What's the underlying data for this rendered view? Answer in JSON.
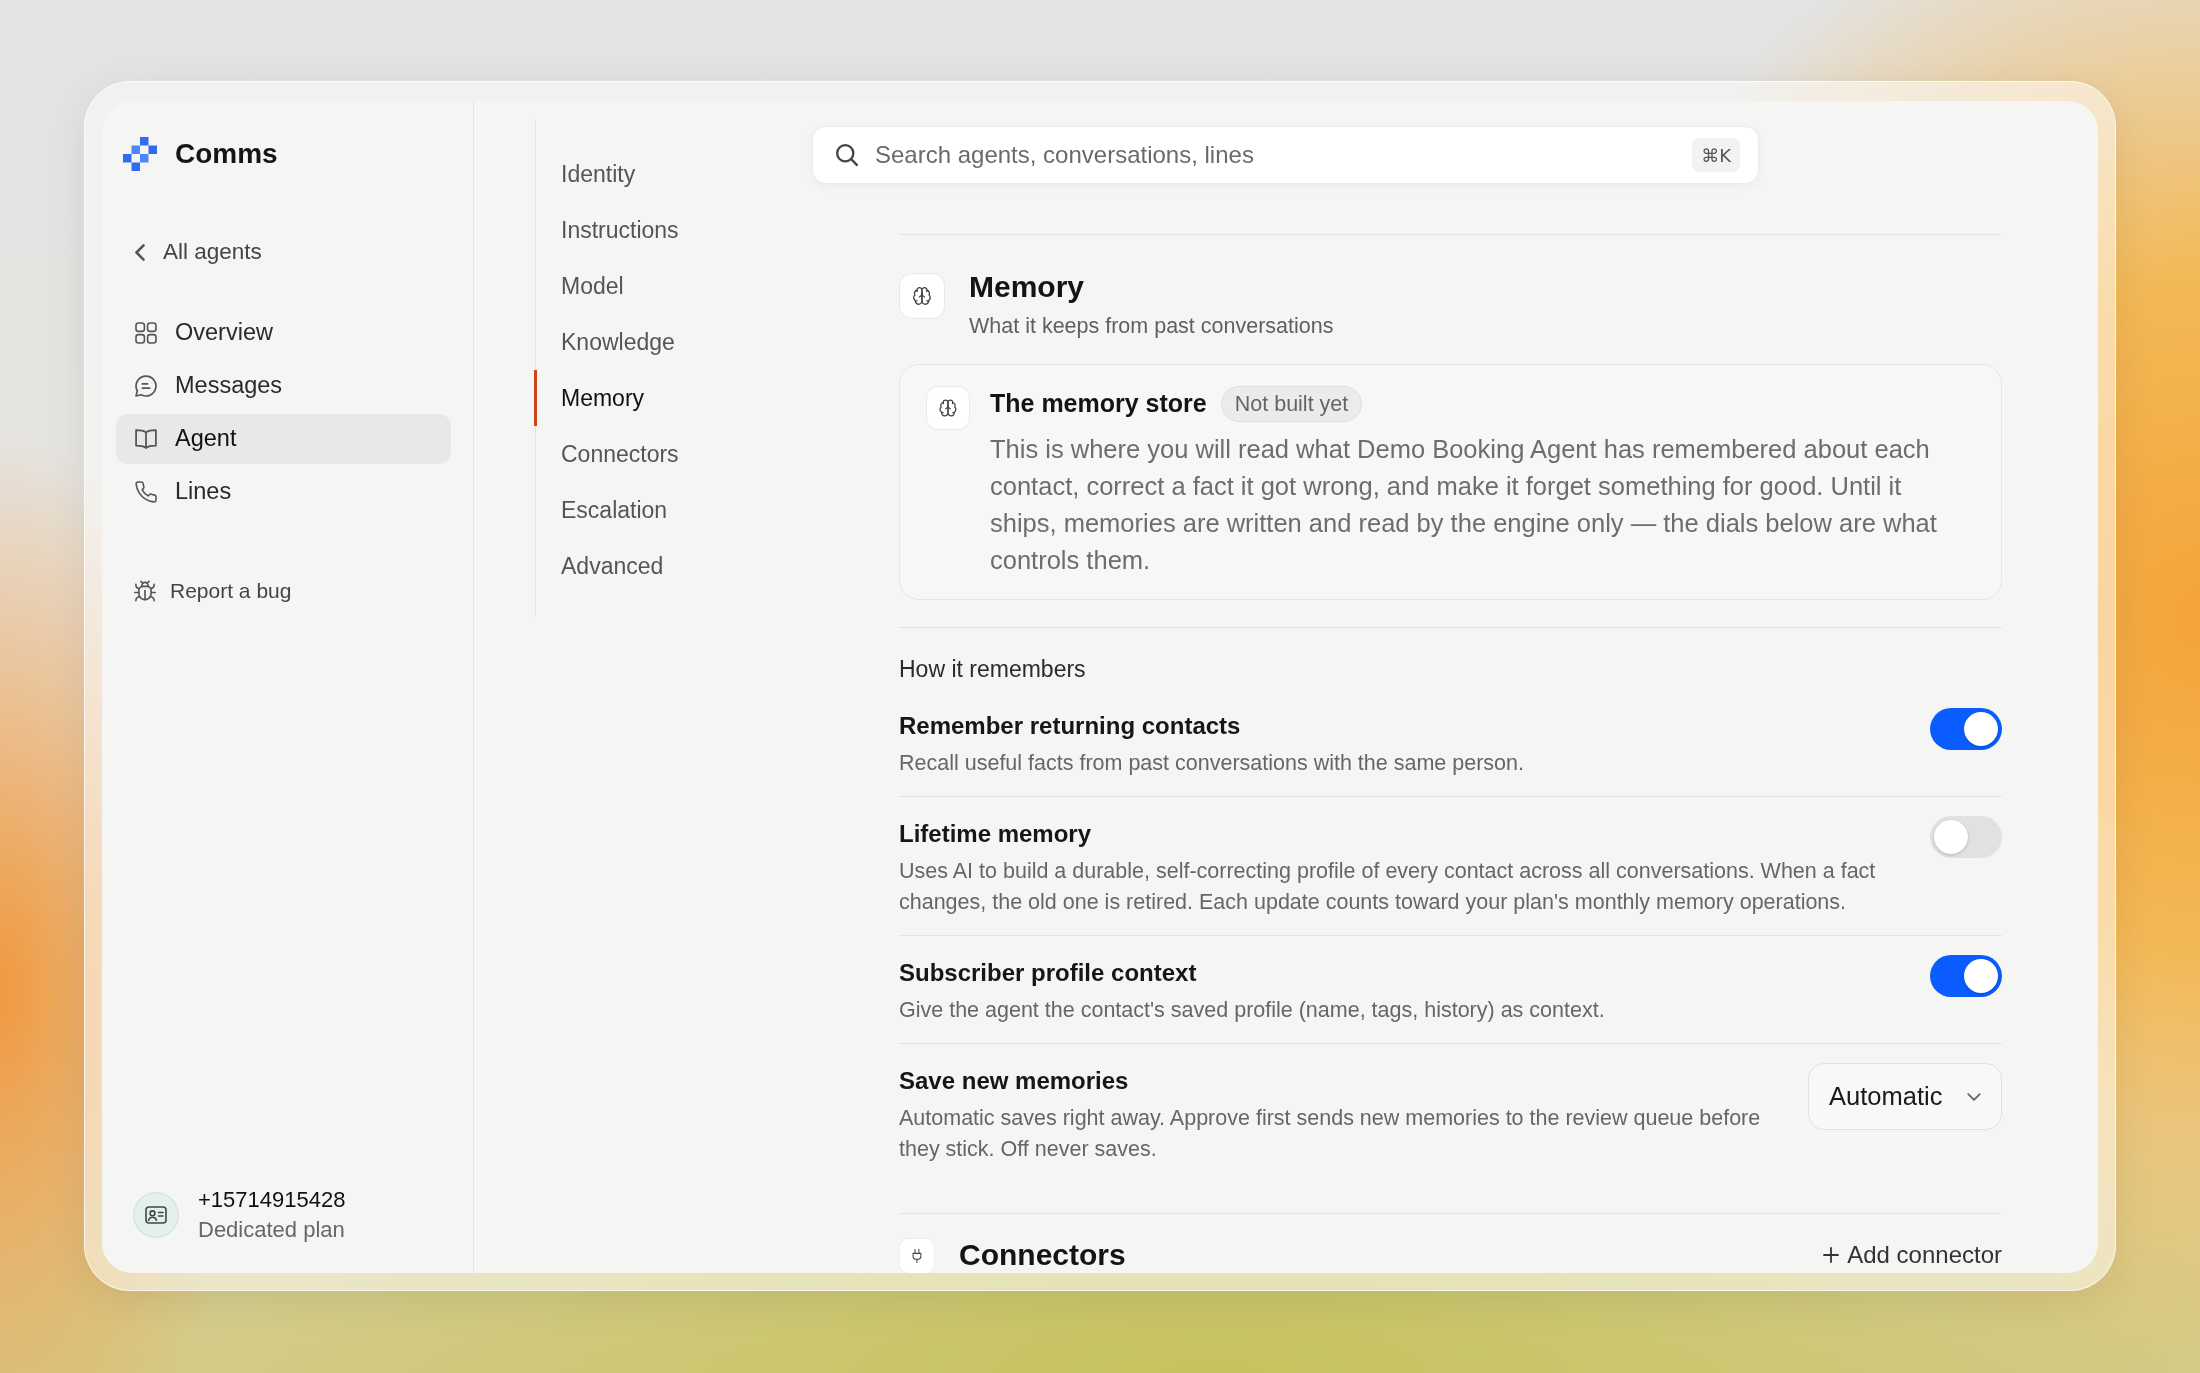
{
  "app": {
    "name": "Comms"
  },
  "sidebar": {
    "back_link": "All agents",
    "items": [
      {
        "label": "Overview",
        "selected": false
      },
      {
        "label": "Messages",
        "selected": false
      },
      {
        "label": "Agent",
        "selected": true
      },
      {
        "label": "Lines",
        "selected": false
      }
    ],
    "report_bug": "Report a bug",
    "account": {
      "phone": "+15714915428",
      "plan": "Dedicated plan"
    }
  },
  "section_nav": {
    "items": [
      {
        "label": "Identity",
        "selected": false
      },
      {
        "label": "Instructions",
        "selected": false
      },
      {
        "label": "Model",
        "selected": false
      },
      {
        "label": "Knowledge",
        "selected": false
      },
      {
        "label": "Memory",
        "selected": true
      },
      {
        "label": "Connectors",
        "selected": false
      },
      {
        "label": "Escalation",
        "selected": false
      },
      {
        "label": "Advanced",
        "selected": false
      }
    ]
  },
  "search": {
    "placeholder": "Search agents, conversations, lines",
    "shortcut": "⌘K"
  },
  "memory": {
    "title": "Memory",
    "subtitle": "What it keeps from past conversations",
    "store_card": {
      "title": "The memory store",
      "badge": "Not built yet",
      "body": "This is where you will read what Demo Booking Agent has remembered about each contact, correct a fact it got wrong, and make it forget something for good. Until it ships, memories are written and read by the engine only — the dials below are what controls them."
    },
    "group_label": "How it remembers",
    "settings": [
      {
        "kind": "toggle",
        "title": "Remember returning contacts",
        "description": "Recall useful facts from past conversations with the same person.",
        "on": true
      },
      {
        "kind": "toggle",
        "title": "Lifetime memory",
        "description": "Uses AI to build a durable, self-correcting profile of every contact across all conversations. When a fact changes, the old one is retired. Each update counts toward your plan's monthly memory operations.",
        "on": false
      },
      {
        "kind": "toggle",
        "title": "Subscriber profile context",
        "description": "Give the agent the contact's saved profile (name, tags, history) as context.",
        "on": true
      },
      {
        "kind": "select",
        "title": "Save new memories",
        "description": "Automatic saves right away. Approve first sends new memories to the review queue before they stick. Off never saves.",
        "value": "Automatic"
      }
    ]
  },
  "connectors": {
    "title": "Connectors",
    "action": "Add connector"
  }
}
